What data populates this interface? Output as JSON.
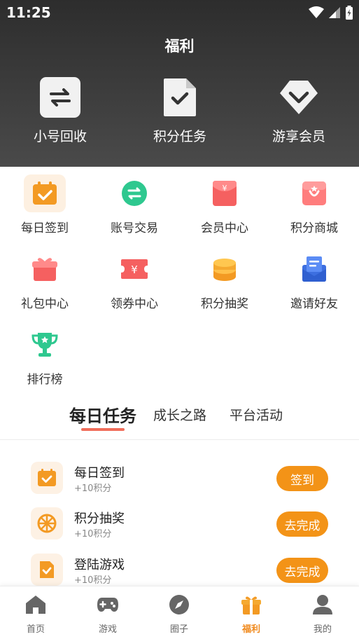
{
  "status_bar": {
    "time": "11:25"
  },
  "page_title": "福利",
  "hero": [
    {
      "label": "小号回收",
      "icon": "swap-icon"
    },
    {
      "label": "积分任务",
      "icon": "document-check-icon"
    },
    {
      "label": "游享会员",
      "icon": "diamond-icon"
    }
  ],
  "grid": [
    {
      "label": "每日签到",
      "icon": "calendar-check-icon"
    },
    {
      "label": "账号交易",
      "icon": "exchange-icon"
    },
    {
      "label": "会员中心",
      "icon": "red-envelope-icon"
    },
    {
      "label": "积分商城",
      "icon": "shop-icon"
    },
    {
      "label": "礼包中心",
      "icon": "gift-icon"
    },
    {
      "label": "领券中心",
      "icon": "ticket-icon"
    },
    {
      "label": "积分抽奖",
      "icon": "coins-icon"
    },
    {
      "label": "邀请好友",
      "icon": "invite-icon"
    },
    {
      "label": "排行榜",
      "icon": "trophy-icon"
    }
  ],
  "tabs": [
    {
      "label": "每日任务",
      "active": true
    },
    {
      "label": "成长之路",
      "active": false
    },
    {
      "label": "平台活动",
      "active": false
    }
  ],
  "tasks": [
    {
      "name": "每日签到",
      "points": "+10积分",
      "button": "签到",
      "icon": "calendar-check-icon"
    },
    {
      "name": "积分抽奖",
      "points": "+10积分",
      "button": "去完成",
      "icon": "wheel-icon"
    },
    {
      "name": "登陆游戏",
      "points": "+10积分",
      "button": "去完成",
      "icon": "doc-check-icon"
    }
  ],
  "bottom_nav": [
    {
      "label": "首页",
      "icon": "home-icon",
      "active": false
    },
    {
      "label": "游戏",
      "icon": "gamepad-icon",
      "active": false
    },
    {
      "label": "圈子",
      "icon": "compass-icon",
      "active": false
    },
    {
      "label": "福利",
      "icon": "gift-icon",
      "active": true
    },
    {
      "label": "我的",
      "icon": "user-icon",
      "active": false
    }
  ],
  "colors": {
    "accent": "#f39317",
    "tab_underline": "#f06d5a",
    "nav_active": "#f08a1e"
  }
}
